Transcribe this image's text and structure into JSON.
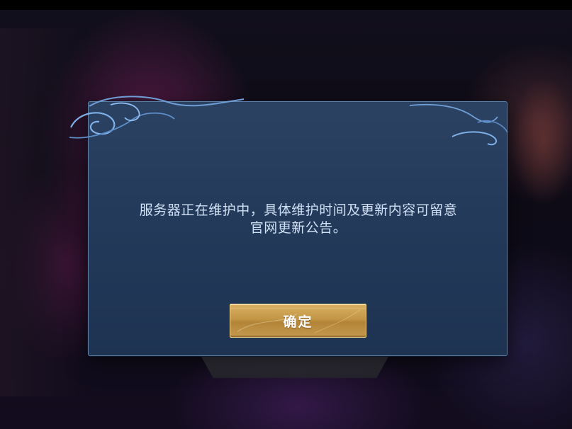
{
  "dialog": {
    "message_lines": [
      "服务器正在维护中，具体维护时间及更新内容可留意",
      "官网更新公告。"
    ],
    "confirm_label": "确定"
  },
  "colors": {
    "panel_top": "#2c4263",
    "panel_bottom": "#1e3352",
    "panel_border": "#5e7fa6",
    "message_text": "#cfe0f4",
    "button_gold": "#c39646",
    "button_border": "#f3d48a"
  }
}
